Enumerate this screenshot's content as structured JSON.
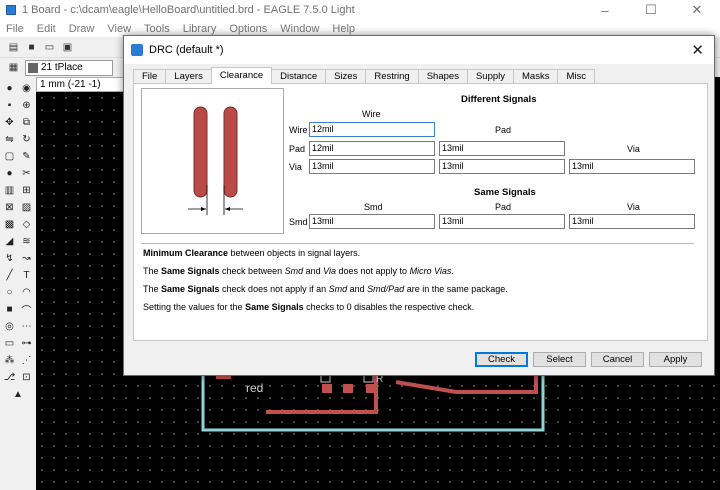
{
  "window": {
    "title": "1 Board - c:\\dcam\\eagle\\HelloBoard\\untitled.brd - EAGLE 7.5.0 Light",
    "controls": {
      "minimize": "–",
      "maximize": "☐",
      "close": "✕"
    }
  },
  "menu": [
    "File",
    "Edit",
    "Draw",
    "View",
    "Tools",
    "Library",
    "Options",
    "Window",
    "Help"
  ],
  "layer_select": {
    "value": "21 tPlace",
    "color": "#666666"
  },
  "coord_readout": "1 mm (-21 -1)",
  "canvas_labels": {
    "red": "red",
    "r_label": "R"
  },
  "dialog": {
    "title": "DRC (default *)",
    "close": "✕",
    "tabs": [
      "File",
      "Layers",
      "Clearance",
      "Distance",
      "Sizes",
      "Restring",
      "Shapes",
      "Supply",
      "Masks",
      "Misc"
    ],
    "active_tab": "Clearance",
    "different_signals": {
      "heading": "Different Signals",
      "col_wire": "Wire",
      "col_pad": "Pad",
      "col_via": "Via",
      "row_wire": "Wire",
      "row_pad": "Pad",
      "row_via": "Via",
      "wire_wire": "12mil",
      "pad_wire": "12mil",
      "pad_pad": "13mil",
      "via_wire": "13mil",
      "via_pad": "13mil",
      "via_via": "13mil"
    },
    "same_signals": {
      "heading": "Same Signals",
      "col_smd": "Smd",
      "col_pad": "Pad",
      "col_via": "Via",
      "row_smd": "Smd",
      "smd_smd": "13mil",
      "smd_pad": "13mil",
      "smd_via": "13mil"
    },
    "info": {
      "line1_b": "Minimum Clearance",
      "line1_rest": " between objects in signal layers.",
      "line2_a": "The ",
      "line2_b": "Same Signals",
      "line2_c": " check between ",
      "line2_i1": "Smd",
      "line2_d": " and ",
      "line2_i2": "Via",
      "line2_e": " does not apply to ",
      "line2_i3": "Micro Vias",
      "line2_f": ".",
      "line3_a": "The ",
      "line3_b": "Same Signals",
      "line3_c": " check does not apply if an ",
      "line3_i1": "Smd",
      "line3_d": " and ",
      "line3_i2": "Smd/Pad",
      "line3_e": " are in the same package.",
      "line4_a": "Setting the values for the ",
      "line4_b": "Same Signals",
      "line4_c": " checks to 0 disables the respective check."
    },
    "buttons": {
      "check": "Check",
      "select": "Select",
      "cancel": "Cancel",
      "apply": "Apply"
    }
  },
  "colors": {
    "pad": "#b94a48",
    "trace": "#c0504d",
    "outline": "#8fd3d8"
  }
}
